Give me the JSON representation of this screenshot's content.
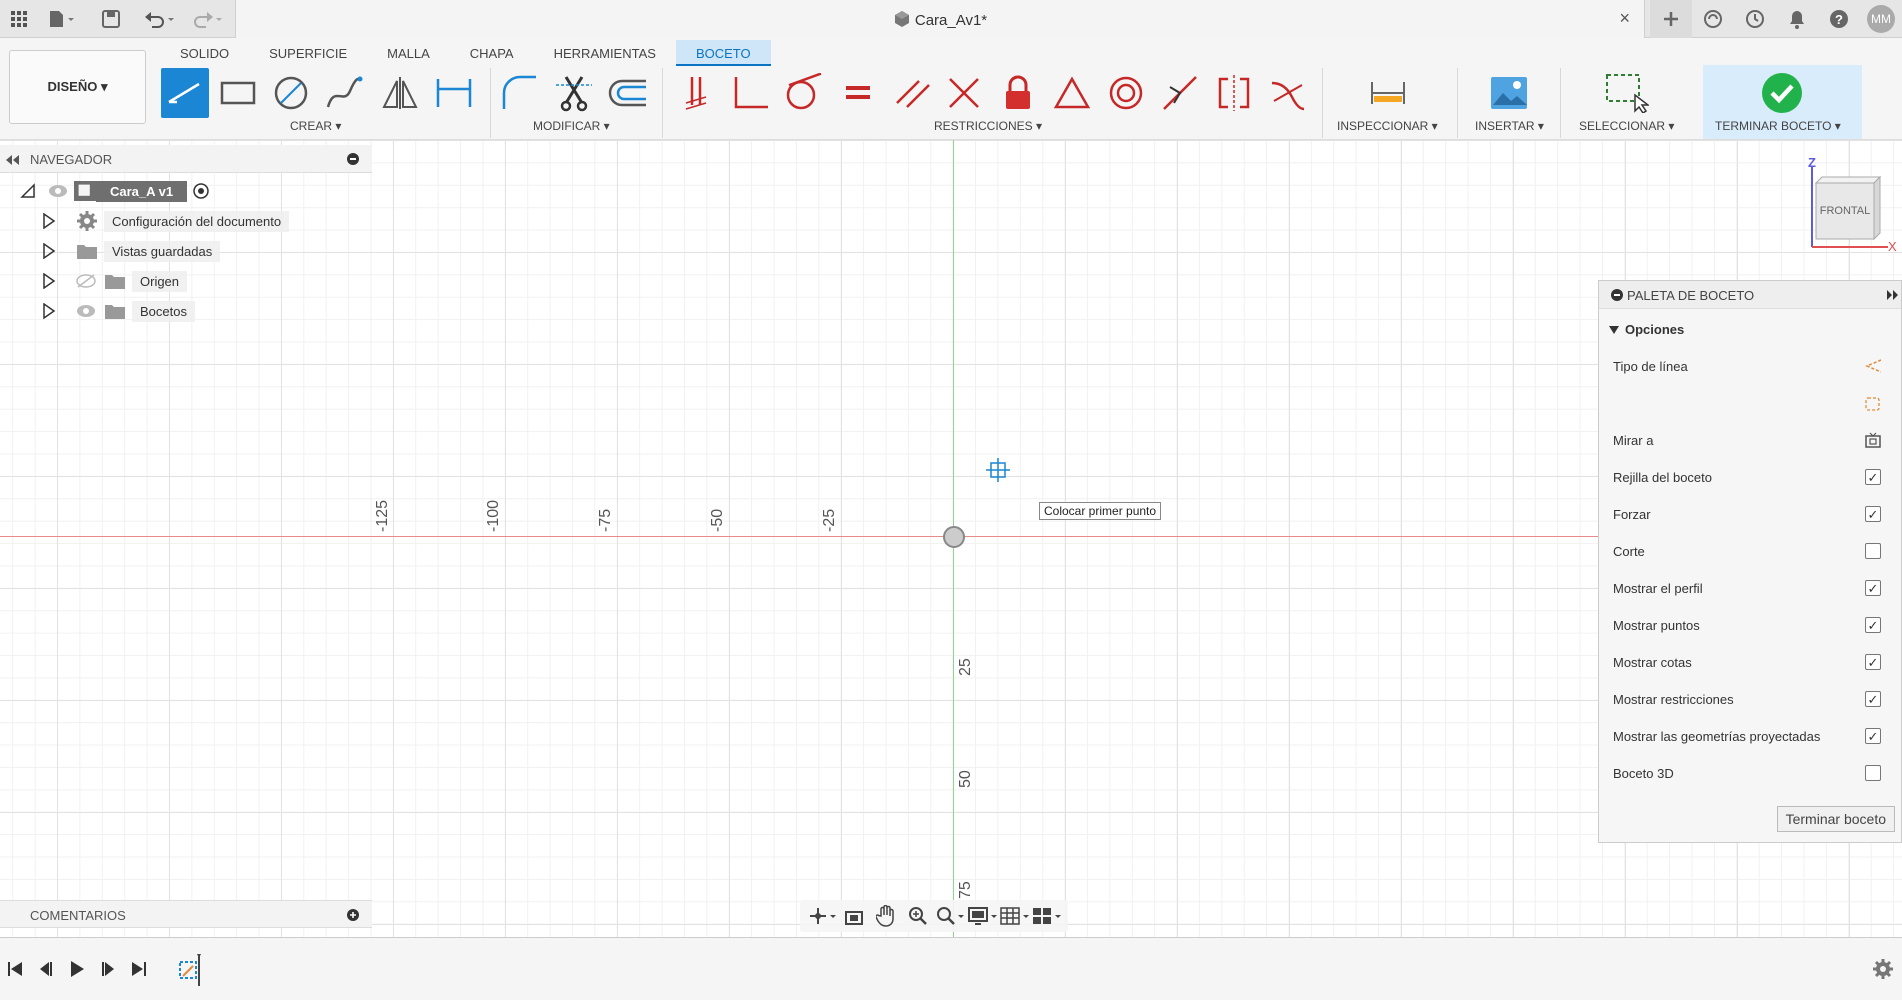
{
  "window": {
    "title": "Cara_Av1*",
    "close_glyph": "×",
    "user_initials": "MM"
  },
  "toolbar": {
    "workspace": "DISEÑO ▾",
    "tabs": [
      "SOLIDO",
      "SUPERFICIE",
      "MALLA",
      "CHAPA",
      "HERRAMIENTAS",
      "BOCETO"
    ],
    "active_tab": "BOCETO",
    "groups": {
      "crear": "CREAR ▾",
      "modificar": "MODIFICAR ▾",
      "restricciones": "RESTRICCIONES ▾",
      "inspeccionar": "INSPECCIONAR ▾",
      "insertar": "INSERTAR ▾",
      "seleccionar": "SELECCIONAR ▾",
      "terminar": "TERMINAR BOCETO ▾"
    }
  },
  "browser": {
    "title": "NAVEGADOR",
    "root": "Cara_A v1",
    "items": [
      {
        "label": "Configuración del documento",
        "icon": "gear-icon"
      },
      {
        "label": "Vistas guardadas",
        "icon": "folder-icon"
      },
      {
        "label": "Origen",
        "icon": "folder-icon"
      },
      {
        "label": "Bocetos",
        "icon": "folder-icon"
      }
    ]
  },
  "canvas": {
    "h_ticks": [
      "-125",
      "-100",
      "-75",
      "-50",
      "-25"
    ],
    "v_ticks": [
      "25",
      "50",
      "75"
    ],
    "tooltip": "Colocar primer punto",
    "viewcube": {
      "face": "FRONTAL",
      "z": "Z",
      "x": "X"
    }
  },
  "palette": {
    "title": "PALETA DE BOCETO",
    "section": "Opciones",
    "rows": [
      {
        "label": "Tipo de línea",
        "type": "icon"
      },
      {
        "label": "",
        "type": "icon"
      },
      {
        "label": "Mirar a",
        "type": "icon"
      },
      {
        "label": "Rejilla del boceto",
        "type": "checkbox",
        "checked": true
      },
      {
        "label": "Forzar",
        "type": "checkbox",
        "checked": true
      },
      {
        "label": "Corte",
        "type": "checkbox",
        "checked": false
      },
      {
        "label": "Mostrar el perfil",
        "type": "checkbox",
        "checked": true
      },
      {
        "label": "Mostrar puntos",
        "type": "checkbox",
        "checked": true
      },
      {
        "label": "Mostrar cotas",
        "type": "checkbox",
        "checked": true
      },
      {
        "label": "Mostrar restricciones",
        "type": "checkbox",
        "checked": true
      },
      {
        "label": "Mostrar las geometrías proyectadas",
        "type": "checkbox",
        "checked": true
      },
      {
        "label": "Boceto 3D",
        "type": "checkbox",
        "checked": false
      }
    ],
    "finish_button": "Terminar boceto",
    "check_glyph": "✓"
  },
  "comments": {
    "title": "COMENTARIOS"
  },
  "colors": {
    "accent": "#1a86d4",
    "x_axis": "#e68a8a",
    "y_axis": "#8ed68e",
    "finish_green": "#22b24c"
  }
}
